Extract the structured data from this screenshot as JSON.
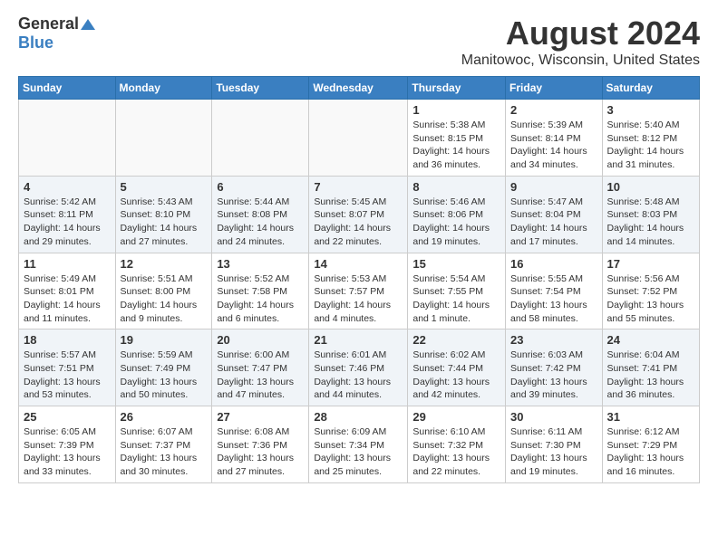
{
  "header": {
    "logo_general": "General",
    "logo_blue": "Blue",
    "month_year": "August 2024",
    "location": "Manitowoc, Wisconsin, United States"
  },
  "calendar": {
    "weekdays": [
      "Sunday",
      "Monday",
      "Tuesday",
      "Wednesday",
      "Thursday",
      "Friday",
      "Saturday"
    ],
    "weeks": [
      [
        {
          "day": "",
          "info": ""
        },
        {
          "day": "",
          "info": ""
        },
        {
          "day": "",
          "info": ""
        },
        {
          "day": "",
          "info": ""
        },
        {
          "day": "1",
          "info": "Sunrise: 5:38 AM\nSunset: 8:15 PM\nDaylight: 14 hours and 36 minutes."
        },
        {
          "day": "2",
          "info": "Sunrise: 5:39 AM\nSunset: 8:14 PM\nDaylight: 14 hours and 34 minutes."
        },
        {
          "day": "3",
          "info": "Sunrise: 5:40 AM\nSunset: 8:12 PM\nDaylight: 14 hours and 31 minutes."
        }
      ],
      [
        {
          "day": "4",
          "info": "Sunrise: 5:42 AM\nSunset: 8:11 PM\nDaylight: 14 hours and 29 minutes."
        },
        {
          "day": "5",
          "info": "Sunrise: 5:43 AM\nSunset: 8:10 PM\nDaylight: 14 hours and 27 minutes."
        },
        {
          "day": "6",
          "info": "Sunrise: 5:44 AM\nSunset: 8:08 PM\nDaylight: 14 hours and 24 minutes."
        },
        {
          "day": "7",
          "info": "Sunrise: 5:45 AM\nSunset: 8:07 PM\nDaylight: 14 hours and 22 minutes."
        },
        {
          "day": "8",
          "info": "Sunrise: 5:46 AM\nSunset: 8:06 PM\nDaylight: 14 hours and 19 minutes."
        },
        {
          "day": "9",
          "info": "Sunrise: 5:47 AM\nSunset: 8:04 PM\nDaylight: 14 hours and 17 minutes."
        },
        {
          "day": "10",
          "info": "Sunrise: 5:48 AM\nSunset: 8:03 PM\nDaylight: 14 hours and 14 minutes."
        }
      ],
      [
        {
          "day": "11",
          "info": "Sunrise: 5:49 AM\nSunset: 8:01 PM\nDaylight: 14 hours and 11 minutes."
        },
        {
          "day": "12",
          "info": "Sunrise: 5:51 AM\nSunset: 8:00 PM\nDaylight: 14 hours and 9 minutes."
        },
        {
          "day": "13",
          "info": "Sunrise: 5:52 AM\nSunset: 7:58 PM\nDaylight: 14 hours and 6 minutes."
        },
        {
          "day": "14",
          "info": "Sunrise: 5:53 AM\nSunset: 7:57 PM\nDaylight: 14 hours and 4 minutes."
        },
        {
          "day": "15",
          "info": "Sunrise: 5:54 AM\nSunset: 7:55 PM\nDaylight: 14 hours and 1 minute."
        },
        {
          "day": "16",
          "info": "Sunrise: 5:55 AM\nSunset: 7:54 PM\nDaylight: 13 hours and 58 minutes."
        },
        {
          "day": "17",
          "info": "Sunrise: 5:56 AM\nSunset: 7:52 PM\nDaylight: 13 hours and 55 minutes."
        }
      ],
      [
        {
          "day": "18",
          "info": "Sunrise: 5:57 AM\nSunset: 7:51 PM\nDaylight: 13 hours and 53 minutes."
        },
        {
          "day": "19",
          "info": "Sunrise: 5:59 AM\nSunset: 7:49 PM\nDaylight: 13 hours and 50 minutes."
        },
        {
          "day": "20",
          "info": "Sunrise: 6:00 AM\nSunset: 7:47 PM\nDaylight: 13 hours and 47 minutes."
        },
        {
          "day": "21",
          "info": "Sunrise: 6:01 AM\nSunset: 7:46 PM\nDaylight: 13 hours and 44 minutes."
        },
        {
          "day": "22",
          "info": "Sunrise: 6:02 AM\nSunset: 7:44 PM\nDaylight: 13 hours and 42 minutes."
        },
        {
          "day": "23",
          "info": "Sunrise: 6:03 AM\nSunset: 7:42 PM\nDaylight: 13 hours and 39 minutes."
        },
        {
          "day": "24",
          "info": "Sunrise: 6:04 AM\nSunset: 7:41 PM\nDaylight: 13 hours and 36 minutes."
        }
      ],
      [
        {
          "day": "25",
          "info": "Sunrise: 6:05 AM\nSunset: 7:39 PM\nDaylight: 13 hours and 33 minutes."
        },
        {
          "day": "26",
          "info": "Sunrise: 6:07 AM\nSunset: 7:37 PM\nDaylight: 13 hours and 30 minutes."
        },
        {
          "day": "27",
          "info": "Sunrise: 6:08 AM\nSunset: 7:36 PM\nDaylight: 13 hours and 27 minutes."
        },
        {
          "day": "28",
          "info": "Sunrise: 6:09 AM\nSunset: 7:34 PM\nDaylight: 13 hours and 25 minutes."
        },
        {
          "day": "29",
          "info": "Sunrise: 6:10 AM\nSunset: 7:32 PM\nDaylight: 13 hours and 22 minutes."
        },
        {
          "day": "30",
          "info": "Sunrise: 6:11 AM\nSunset: 7:30 PM\nDaylight: 13 hours and 19 minutes."
        },
        {
          "day": "31",
          "info": "Sunrise: 6:12 AM\nSunset: 7:29 PM\nDaylight: 13 hours and 16 minutes."
        }
      ]
    ]
  }
}
